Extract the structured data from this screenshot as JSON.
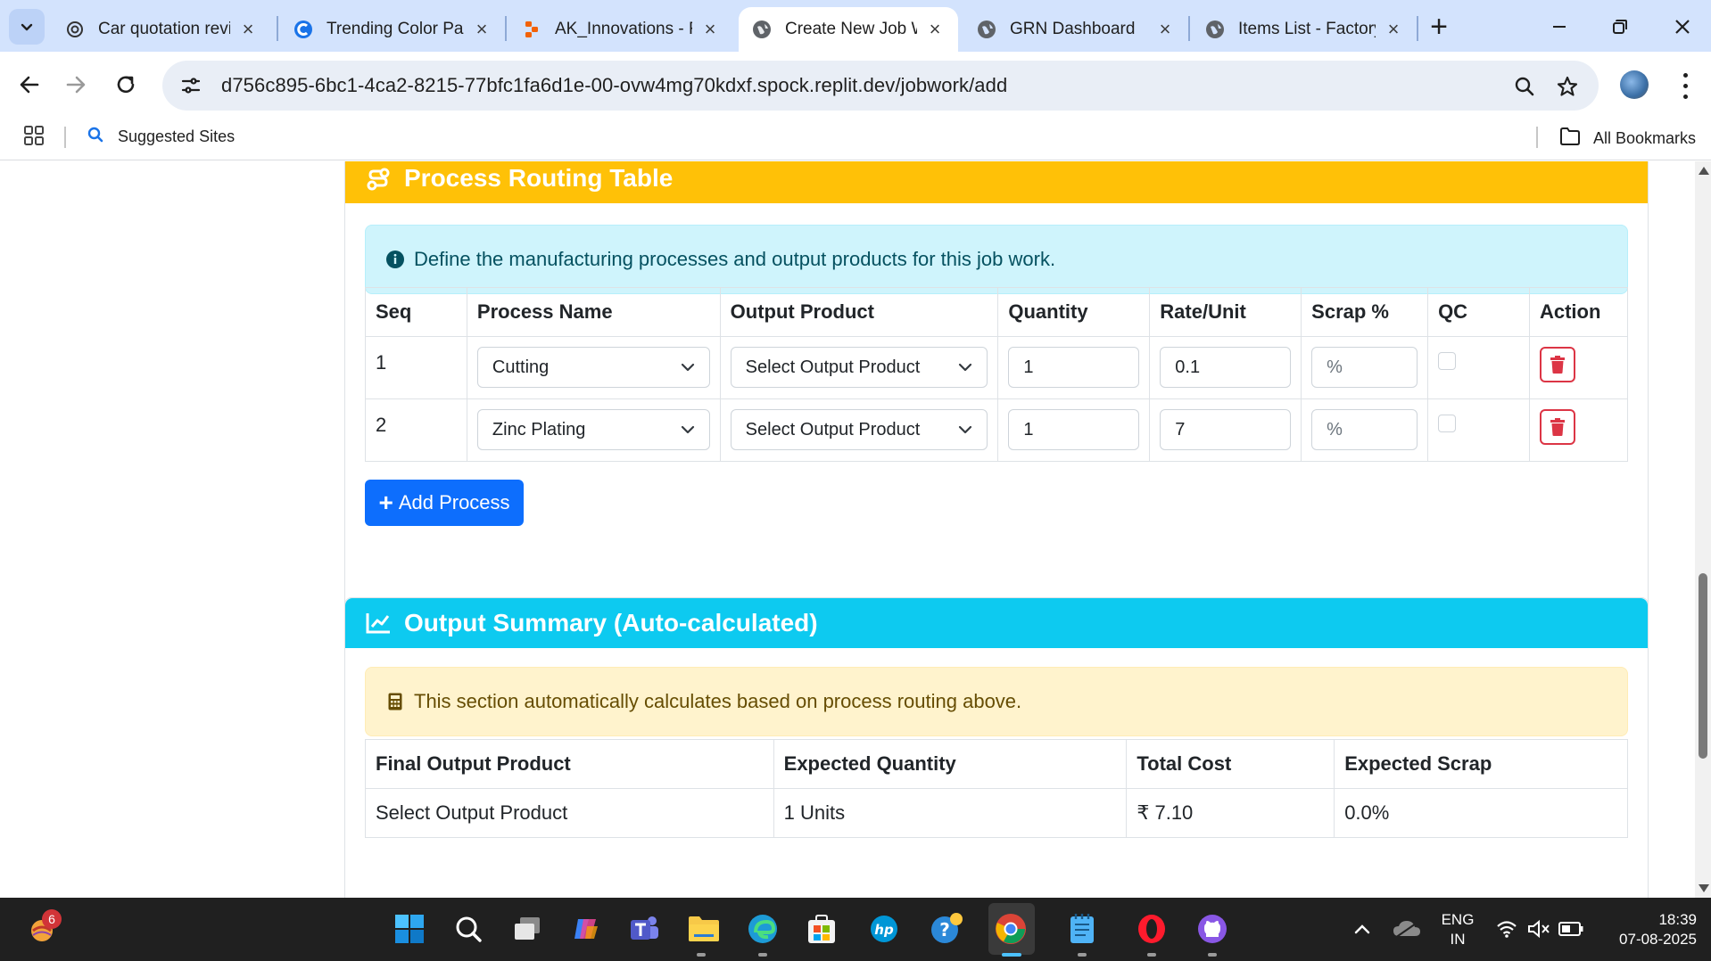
{
  "browser": {
    "tabs": [
      {
        "title": "Car quotation revie",
        "icon": "openai-icon",
        "active": false
      },
      {
        "title": "Trending Color Pal",
        "icon": "coolors-icon",
        "active": false
      },
      {
        "title": "AK_Innovations - F",
        "icon": "replit-icon",
        "active": false
      },
      {
        "title": "Create New Job W",
        "icon": "globe-icon",
        "active": true
      },
      {
        "title": "GRN Dashboard",
        "icon": "globe-icon",
        "active": false
      },
      {
        "title": "Items List - Factory",
        "icon": "globe-icon",
        "active": false
      }
    ],
    "url": "d756c895-6bc1-4ca2-8215-77bfc1fa6d1e-00-ovw4mg70kdxf.spock.replit.dev/jobwork/add",
    "bookmarks": {
      "suggested": "Suggested Sites",
      "all": "All Bookmarks"
    }
  },
  "routing": {
    "title": "Process Routing Table",
    "info": "Define the manufacturing processes and output products for this job work.",
    "columns": [
      "Seq",
      "Process Name",
      "Output Product",
      "Quantity",
      "Rate/Unit",
      "Scrap %",
      "QC",
      "Action"
    ],
    "rows": [
      {
        "seq": "1",
        "process": "Cutting",
        "output": "Select Output Product",
        "quantity": "1",
        "rate": "0.1",
        "scrap_placeholder": "%",
        "qc": false
      },
      {
        "seq": "2",
        "process": "Zinc Plating",
        "output": "Select Output Product",
        "quantity": "1",
        "rate": "7",
        "scrap_placeholder": "%",
        "qc": false
      }
    ],
    "add_button": "Add Process"
  },
  "summary": {
    "title": "Output Summary (Auto-calculated)",
    "note": "This section automatically calculates based on process routing above.",
    "columns": [
      "Final Output Product",
      "Expected Quantity",
      "Total Cost",
      "Expected Scrap"
    ],
    "row": {
      "product": "Select Output Product",
      "quantity": "1 Units",
      "cost": "₹ 7.10",
      "scrap": "0.0%"
    }
  },
  "taskbar": {
    "notification_count": "6",
    "lang_top": "ENG",
    "lang_bottom": "IN",
    "time": "18:39",
    "date": "07-08-2025"
  },
  "colors": {
    "routing_header": "#ffc107",
    "summary_header": "#0dcaf0",
    "primary": "#0d6efd",
    "danger": "#dc3545"
  }
}
